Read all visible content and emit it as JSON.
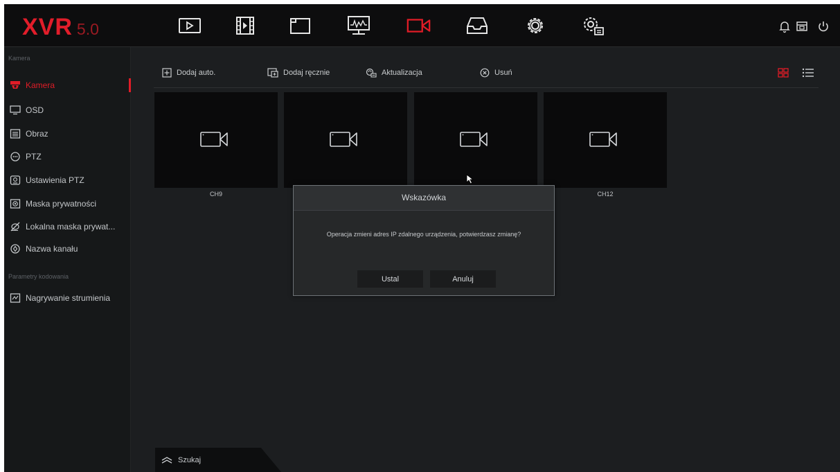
{
  "app": {
    "logo": "XVR",
    "version": "5.0"
  },
  "sidebar": {
    "section_camera": "Kamera",
    "items": [
      {
        "label": "Kamera",
        "icon": "camera-icon"
      },
      {
        "label": "OSD",
        "icon": "monitor-icon"
      },
      {
        "label": "Obraz",
        "icon": "image-settings-icon"
      },
      {
        "label": "PTZ",
        "icon": "ptz-icon"
      },
      {
        "label": "Ustawienia PTZ",
        "icon": "ptz-settings-icon"
      },
      {
        "label": "Maska prywatności",
        "icon": "privacy-mask-icon"
      },
      {
        "label": "Lokalna maska prywat...",
        "icon": "local-mask-icon"
      },
      {
        "label": "Nazwa kanału",
        "icon": "channel-name-icon"
      }
    ],
    "section_encoding": "Parametry kodowania",
    "encoding_items": [
      {
        "label": "Nagrywanie strumienia",
        "icon": "stream-record-icon"
      }
    ]
  },
  "toolbar": {
    "add_auto": "Dodaj auto.",
    "add_manual": "Dodaj ręcznie",
    "update": "Aktualizacja",
    "delete": "Usuń"
  },
  "channels": [
    {
      "label": "CH9"
    },
    {
      "label": ""
    },
    {
      "label": ""
    },
    {
      "label": "CH12"
    }
  ],
  "search": {
    "label": "Szukaj"
  },
  "dialog": {
    "title": "Wskazówka",
    "message": "Operacja zmieni adres IP zdalnego urządzenia, potwierdzasz zmianę?",
    "confirm": "Ustal",
    "cancel": "Anuluj"
  },
  "colors": {
    "accent": "#e01c27",
    "background": "#1c1e20",
    "topbar": "#0d0d0e"
  }
}
